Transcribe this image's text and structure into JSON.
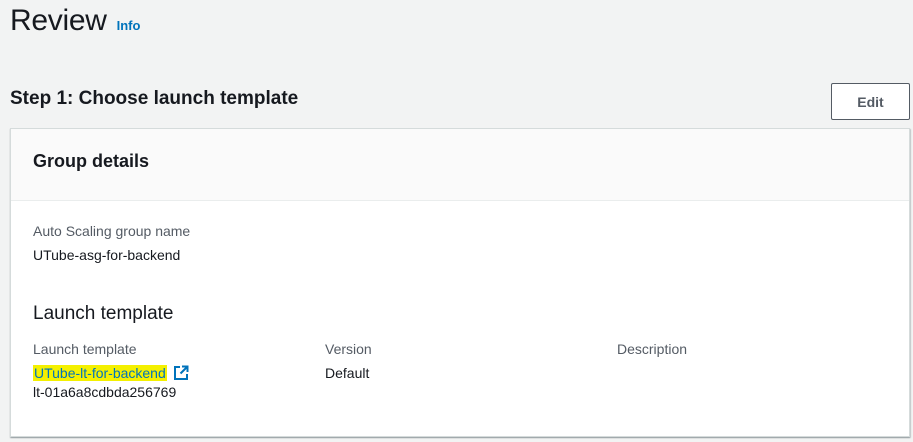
{
  "page": {
    "title": "Review",
    "info_label": "Info"
  },
  "step": {
    "title": "Step 1: Choose launch template",
    "edit_label": "Edit"
  },
  "group_details": {
    "title": "Group details",
    "asg_name_label": "Auto Scaling group name",
    "asg_name_value": "UTube-asg-for-backend",
    "launch_template_section": "Launch template",
    "columns": {
      "launch_template_label": "Launch template",
      "version_label": "Version",
      "description_label": "Description"
    },
    "launch_template_name": "UTube-lt-for-backend",
    "launch_template_id": "lt-01a6a8cdbda256769",
    "version_value": "Default"
  },
  "colors": {
    "link": "#0073bb",
    "highlight": "#f4f000",
    "background": "#f2f3f3"
  },
  "icons": {
    "external_link": "external-link-icon"
  }
}
